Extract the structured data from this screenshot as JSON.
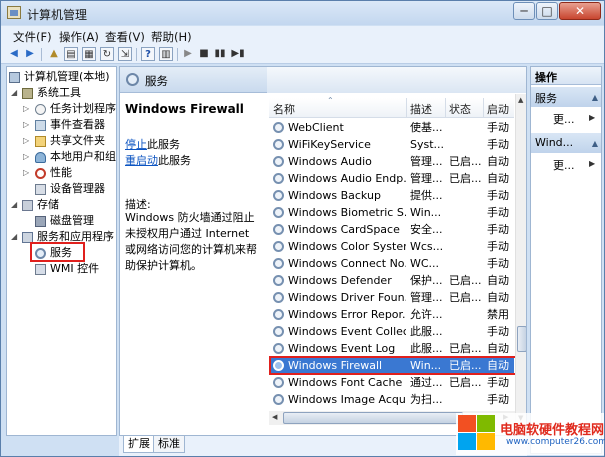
{
  "window": {
    "title": "计算机管理",
    "min": "─",
    "max": "□",
    "close": "✕"
  },
  "menu": [
    "文件(F)",
    "操作(A)",
    "查看(V)",
    "帮助(H)"
  ],
  "tree": [
    {
      "label": "计算机管理(本地)",
      "icon": "computer-icon"
    },
    {
      "label": "系统工具",
      "icon": "tools-icon"
    },
    {
      "label": "任务计划程序",
      "icon": "clock-icon"
    },
    {
      "label": "事件查看器",
      "icon": "event-log-icon"
    },
    {
      "label": "共享文件夹",
      "icon": "folder-icon"
    },
    {
      "label": "本地用户和组",
      "icon": "users-icon"
    },
    {
      "label": "性能",
      "icon": "performance-icon"
    },
    {
      "label": "设备管理器",
      "icon": "device-manager-icon"
    },
    {
      "label": "存储",
      "icon": "storage-icon"
    },
    {
      "label": "磁盘管理",
      "icon": "disk-icon"
    },
    {
      "label": "服务和应用程序",
      "icon": "services-apps-icon"
    },
    {
      "label": "服务",
      "icon": "gear-icon"
    },
    {
      "label": "WMI 控件",
      "icon": "wmi-icon"
    }
  ],
  "header": {
    "title": "服务"
  },
  "detail": {
    "service_name": "Windows Firewall",
    "stop_link": "停止",
    "stop_suffix": "此服务",
    "restart_link": "重启动",
    "restart_suffix": "此服务",
    "desc_label": "描述:",
    "desc_text": "Windows 防火墙通过阻止未授权用户通过 Internet 或网络访问您的计算机来帮助保护计算机。"
  },
  "columns": {
    "name": "名称",
    "desc": "描述",
    "status": "状态",
    "startup": "启动"
  },
  "services": [
    {
      "name": "WebClient",
      "desc": "使基...",
      "status": "",
      "startup": "手动"
    },
    {
      "name": "WiFiKeyService",
      "desc": "Syst...",
      "status": "",
      "startup": "手动"
    },
    {
      "name": "Windows Audio",
      "desc": "管理...",
      "status": "已启...",
      "startup": "自动"
    },
    {
      "name": "Windows Audio Endp...",
      "desc": "管理...",
      "status": "已启...",
      "startup": "自动"
    },
    {
      "name": "Windows Backup",
      "desc": "提供...",
      "status": "",
      "startup": "手动"
    },
    {
      "name": "Windows Biometric S...",
      "desc": "Win...",
      "status": "",
      "startup": "手动"
    },
    {
      "name": "Windows CardSpace",
      "desc": "安全...",
      "status": "",
      "startup": "手动"
    },
    {
      "name": "Windows Color System",
      "desc": "Wcs...",
      "status": "",
      "startup": "手动"
    },
    {
      "name": "Windows Connect No...",
      "desc": "WC...",
      "status": "",
      "startup": "手动"
    },
    {
      "name": "Windows Defender",
      "desc": "保护...",
      "status": "已启...",
      "startup": "自动"
    },
    {
      "name": "Windows Driver Foun...",
      "desc": "管理...",
      "status": "已启...",
      "startup": "自动"
    },
    {
      "name": "Windows Error Repor...",
      "desc": "允许...",
      "status": "",
      "startup": "禁用"
    },
    {
      "name": "Windows Event Collec...",
      "desc": "此服...",
      "status": "",
      "startup": "手动"
    },
    {
      "name": "Windows Event Log",
      "desc": "此服...",
      "status": "已启...",
      "startup": "自动"
    },
    {
      "name": "Windows Firewall",
      "desc": "Win...",
      "status": "已启...",
      "startup": "自动",
      "selected": true
    },
    {
      "name": "Windows Font Cache ...",
      "desc": "通过...",
      "status": "已启...",
      "startup": "手动"
    },
    {
      "name": "Windows Image Acqu...",
      "desc": "为扫...",
      "status": "",
      "startup": "手动"
    }
  ],
  "tabs": [
    "扩展",
    "标准"
  ],
  "actions": {
    "title": "操作",
    "section1": "服务",
    "more1": "更...",
    "section2": "Wind...",
    "more2": "更..."
  },
  "watermark": {
    "text": "电脑软硬件教程网",
    "url": "www.computer26.com"
  },
  "colors": {
    "selection": "#3a78d2",
    "highlight_box": "#e0201d",
    "link": "#0d55c2"
  }
}
